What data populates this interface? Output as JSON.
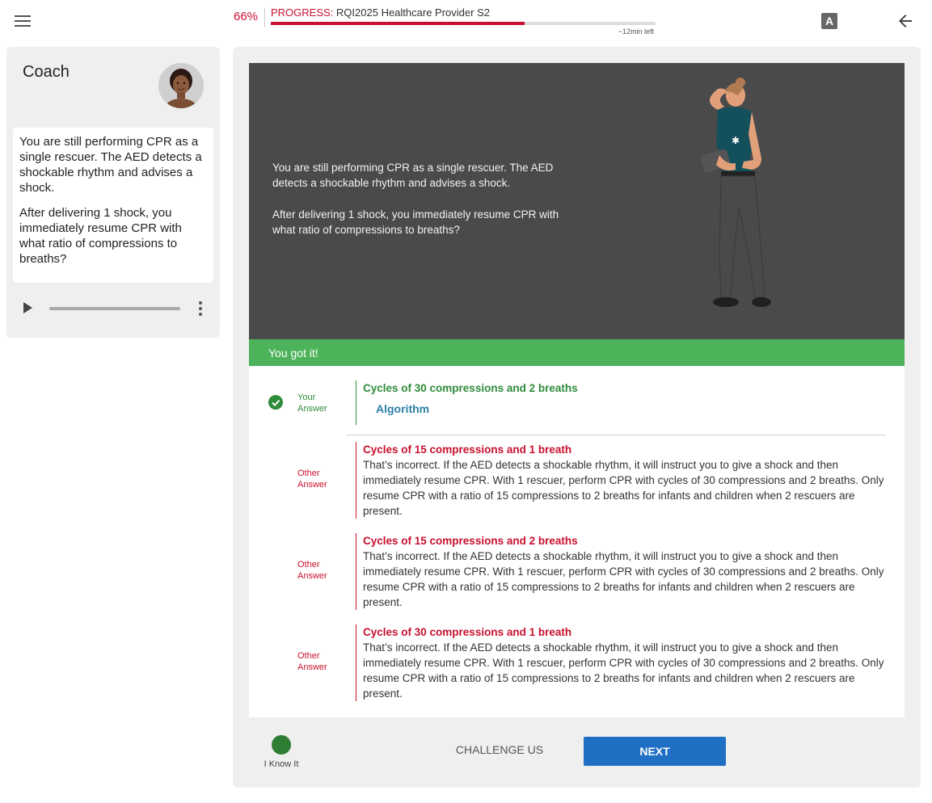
{
  "header": {
    "progress_percent_text": "66%",
    "progress_fraction": 0.66,
    "progress_label_key": "PROGRESS:",
    "progress_label_value": "RQI2025 Healthcare Provider S2",
    "time_left": "~12min  left",
    "font_button_label": "A",
    "menu_icon": "hamburger-menu-icon",
    "back_icon": "arrow-left-icon"
  },
  "coach": {
    "title": "Coach",
    "message_1": "You are still performing CPR as a single rescuer. The AED detects a shockable rhythm and advises a shock.",
    "message_2": "After delivering 1 shock, you immediately resume CPR with what ratio of compressions to breaths?",
    "play_icon": "play-icon",
    "more_icon": "more-vertical-icon"
  },
  "scene": {
    "text_1": "You are still performing CPR as a single rescuer. The AED detects a shockable rhythm and advises a shock.",
    "text_2": "After delivering 1 shock, you immediately resume CPR with what ratio of compressions to breaths?"
  },
  "feedback": {
    "message": "You got it!",
    "color": "#4db35a"
  },
  "answers": [
    {
      "tag": "Your Answer",
      "status": "correct",
      "title": "Cycles of 30 compressions and 2 breaths",
      "link": "Algorithm"
    },
    {
      "tag": "Other Answer",
      "status": "wrong",
      "title": "Cycles of 15 compressions and 1 breath",
      "explanation": "That’s incorrect. If the AED detects a shockable rhythm, it will instruct you to give a shock and then immediately resume CPR. With 1 rescuer, perform CPR with cycles of 30 compressions and 2 breaths. Only resume CPR with a ratio of 15 compressions to 2 breaths for infants and children when 2 rescuers are present."
    },
    {
      "tag": "Other Answer",
      "status": "wrong",
      "title": "Cycles of 15 compressions and 2 breaths",
      "explanation": "That’s incorrect. If the AED detects a shockable rhythm, it will instruct you to give a shock and then immediately resume CPR. With 1 rescuer, perform CPR with cycles of 30 compressions and 2 breaths. Only resume CPR with a ratio of 15 compressions to 2 breaths for infants and children when 2 rescuers are present."
    },
    {
      "tag": "Other Answer",
      "status": "wrong",
      "title": "Cycles of 30 compressions and 1 breath",
      "explanation": "That’s incorrect. If the AED detects a shockable rhythm, it will instruct you to give a shock and then immediately resume CPR. With 1 rescuer, perform CPR with cycles of 30 compressions and 2 breaths. Only resume CPR with a ratio of 15 compressions to 2 breaths for infants and children when 2 rescuers are present."
    }
  ],
  "footer": {
    "know_it_label": "I Know It",
    "challenge_label": "CHALLENGE US",
    "next_label": "NEXT"
  },
  "colors": {
    "brand_red": "#c8102e",
    "correct_green": "#2e8b3a",
    "next_blue": "#1f6fc5",
    "scene_bg": "#4a4a4a"
  }
}
